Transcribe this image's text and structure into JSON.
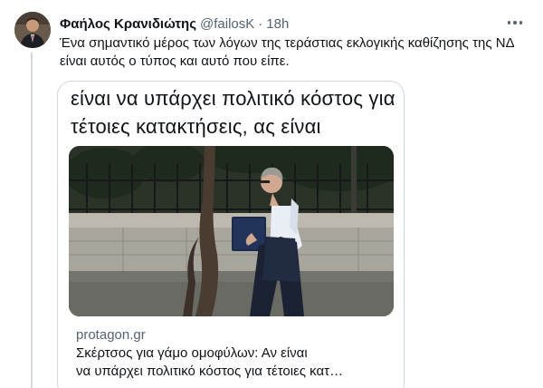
{
  "tweet": {
    "author_name": "Φαήλος Κρανιδιώτης",
    "author_handle": "@failosK",
    "separator": "·",
    "timestamp": "18h",
    "text": "Ένα σημαντικό μέρος των λόγων της τεράστιας εκλογικής καθίζησης της ΝΔ είναι αυτός ο τύπος και αυτό που είπε.",
    "more_icon": "more-horizontal-icon"
  },
  "card": {
    "quote_text": "είναι να υπάρχει πολιτικό κόστος για τέτοιες κατακτήσεις, ας είναι",
    "domain": "protagon.gr",
    "title_line1": "Σκέρτσος για γάμο ομοφύλων: Αν είναι",
    "title_line2": "να υπάρχει πολιτικό κόστος για τέτοιες κατ…"
  },
  "colors": {
    "text_primary": "#0f1419",
    "text_secondary": "#536471",
    "border": "#cfd9de"
  }
}
